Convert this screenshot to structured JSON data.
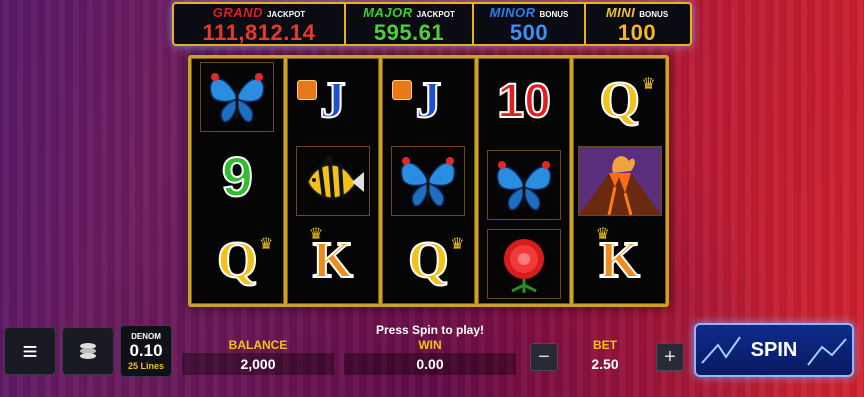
{
  "jackpots": {
    "grand": {
      "name": "GRAND",
      "tag": "JACKPOT",
      "value": "111,812.14"
    },
    "major": {
      "name": "MAJOR",
      "tag": "JACKPOT",
      "value": "595.61"
    },
    "minor": {
      "name": "MINOR",
      "tag": "BONUS",
      "value": "500"
    },
    "mini": {
      "name": "MINI",
      "tag": "BONUS",
      "value": "100"
    }
  },
  "reels": [
    [
      "butterfly",
      "9",
      "Q"
    ],
    [
      "J",
      "fish",
      "K"
    ],
    [
      "J",
      "butterfly",
      "Q"
    ],
    [
      "10",
      "butterfly",
      "flower"
    ],
    [
      "Q",
      "volcano",
      "K"
    ]
  ],
  "symbols": {
    "nine": "9",
    "ten": "10",
    "jack": "J",
    "queen": "Q",
    "king": "K"
  },
  "controls": {
    "denom_label": "DENOM",
    "denom_value": "0.10",
    "lines": "25 Lines",
    "balance_label": "BALANCE",
    "balance_value": "2,000",
    "win_label": "WIN",
    "win_value": "0.00",
    "bet_label": "BET",
    "bet_value": "2.50",
    "minus": "−",
    "plus": "+",
    "prompt": "Press Spin to play!",
    "spin_label": "SPIN",
    "menu_icon": "≡",
    "chips_icon": "coins-icon"
  },
  "colors": {
    "grand": "#e02020",
    "major": "#36d12a",
    "minor": "#2d7ef0",
    "mini": "#f0c22a",
    "frame_gold": "#c9a227"
  }
}
